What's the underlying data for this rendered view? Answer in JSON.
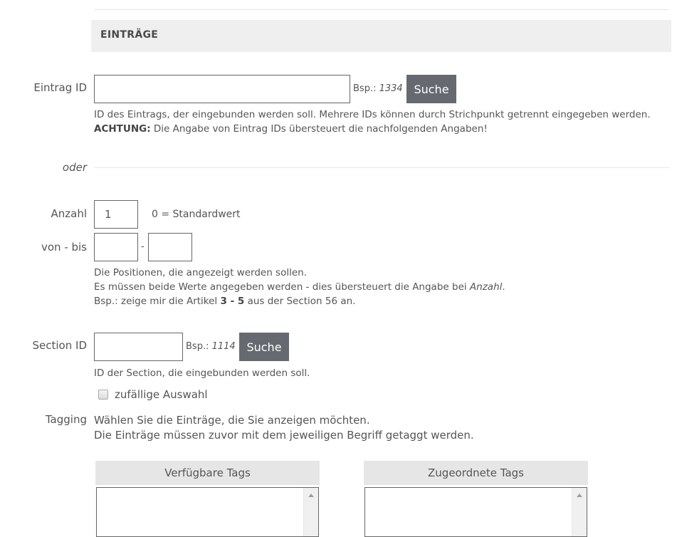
{
  "section": {
    "title": "EINTRÄGE"
  },
  "entry": {
    "label": "Eintrag ID",
    "value": "",
    "example_prefix": "Bsp.: ",
    "example_value": "1334",
    "search_label": "Suche",
    "desc_line1": "ID des Eintrags, der eingebunden werden soll. Mehrere IDs können durch Strichpunkt getrennt eingegeben werden.",
    "desc_warning_bold": "ACHTUNG:",
    "desc_warning_text": " Die Angabe von Eintrag IDs übersteuert die nachfolgenden Angaben!"
  },
  "divider": {
    "label": "oder"
  },
  "count": {
    "label": "Anzahl",
    "value": "1",
    "hint": "0 = Standardwert"
  },
  "range": {
    "label": "von - bis",
    "from_value": "",
    "to_value": "",
    "separator": "-",
    "desc_line1": "Die Positionen, die angezeigt werden sollen.",
    "desc_line2_text": "Es müssen beide Werte angegeben werden - dies übersteuert die Angabe bei ",
    "desc_line2_italic": "Anzahl",
    "desc_line2_end": ".",
    "desc_line3_pre": "Bsp.: zeige mir die Artikel ",
    "desc_line3_bold": "3 - 5",
    "desc_line3_post": " aus der Section 56 an."
  },
  "section_id": {
    "label": "Section ID",
    "value": "",
    "example_prefix": "Bsp.: ",
    "example_value": "1114",
    "search_label": "Suche",
    "desc": "ID der Section, die eingebunden werden soll.",
    "random_label": "zufällige Auswahl",
    "random_checked": false
  },
  "tagging": {
    "label": "Tagging",
    "desc_line1": "Wählen Sie die Einträge, die Sie anzeigen möchten.",
    "desc_line2": "Die Einträge müssen zuvor mit dem jeweiligen Begriff getaggt werden.",
    "available_title": "Verfügbare Tags",
    "assigned_title": "Zugeordnete Tags",
    "available_items": [],
    "assigned_items": []
  },
  "colors": {
    "button_bg": "#666a70",
    "header_bg": "#efefef",
    "tag_header_bg": "#e6e6e6"
  }
}
